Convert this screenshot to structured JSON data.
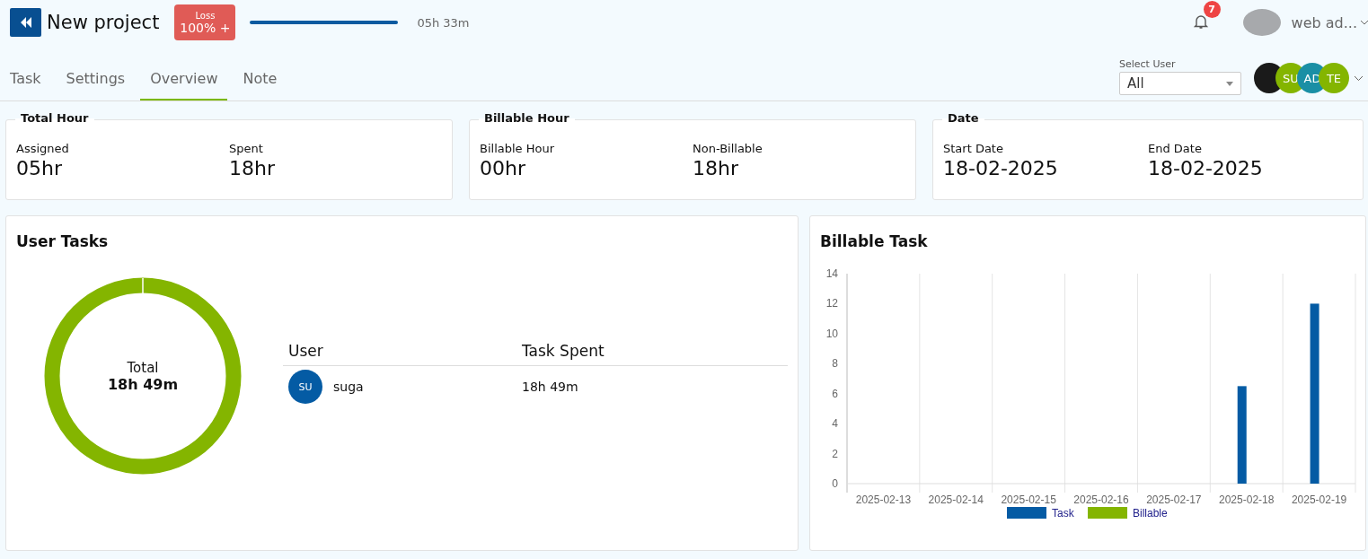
{
  "header": {
    "title": "New project",
    "badge": {
      "label": "Loss",
      "value": "100% +"
    },
    "time": "05h 33m",
    "notifications": "7",
    "user_name": "web ad..."
  },
  "tabs": [
    {
      "label": "Task",
      "selected": false
    },
    {
      "label": "Settings",
      "selected": false
    },
    {
      "label": "Overview",
      "selected": true
    },
    {
      "label": "Note",
      "selected": false
    }
  ],
  "user_filter": {
    "label": "Select User",
    "value": "All"
  },
  "team_avatars": [
    {
      "kind": "photo"
    },
    {
      "kind": "initials",
      "text": "SU",
      "color": "#84b500"
    },
    {
      "kind": "initials",
      "text": "AD",
      "color": "#1a8fa5"
    },
    {
      "kind": "initials",
      "text": "TE",
      "color": "#84b500"
    }
  ],
  "summary_cards": [
    {
      "title": "Total Hour",
      "fields": [
        {
          "label": "Assigned",
          "value": "05hr"
        },
        {
          "label": "Spent",
          "value": "18hr"
        }
      ]
    },
    {
      "title": "Billable Hour",
      "fields": [
        {
          "label": "Billable Hour",
          "value": "00hr"
        },
        {
          "label": "Non-Billable",
          "value": "18hr"
        }
      ]
    },
    {
      "title": "Date",
      "fields": [
        {
          "label": "Start Date",
          "value": "18-02-2025"
        },
        {
          "label": "End Date",
          "value": "18-02-2025"
        }
      ]
    }
  ],
  "user_tasks": {
    "title": "User Tasks",
    "ring_label": "Total",
    "ring_value": "18h 49m",
    "columns": [
      "User",
      "Task Spent"
    ],
    "rows": [
      {
        "initials": "SU",
        "user": "suga",
        "spent": "18h 49m"
      }
    ]
  },
  "billable_task": {
    "title": "Billable Task",
    "chart_data": {
      "type": "bar",
      "categories": [
        "2025-02-13",
        "2025-02-14",
        "2025-02-15",
        "2025-02-16",
        "2025-02-17",
        "2025-02-18",
        "2025-02-19"
      ],
      "series": [
        {
          "name": "Task",
          "color": "#045ba4",
          "values": [
            0,
            0,
            0,
            0,
            0,
            6.5,
            12
          ]
        },
        {
          "name": "Billable",
          "color": "#84b500",
          "values": [
            0,
            0,
            0,
            0,
            0,
            0,
            0
          ]
        }
      ],
      "ylim": [
        0,
        14
      ],
      "yticks": [
        0,
        2,
        4,
        6,
        8,
        10,
        12,
        14
      ]
    }
  }
}
